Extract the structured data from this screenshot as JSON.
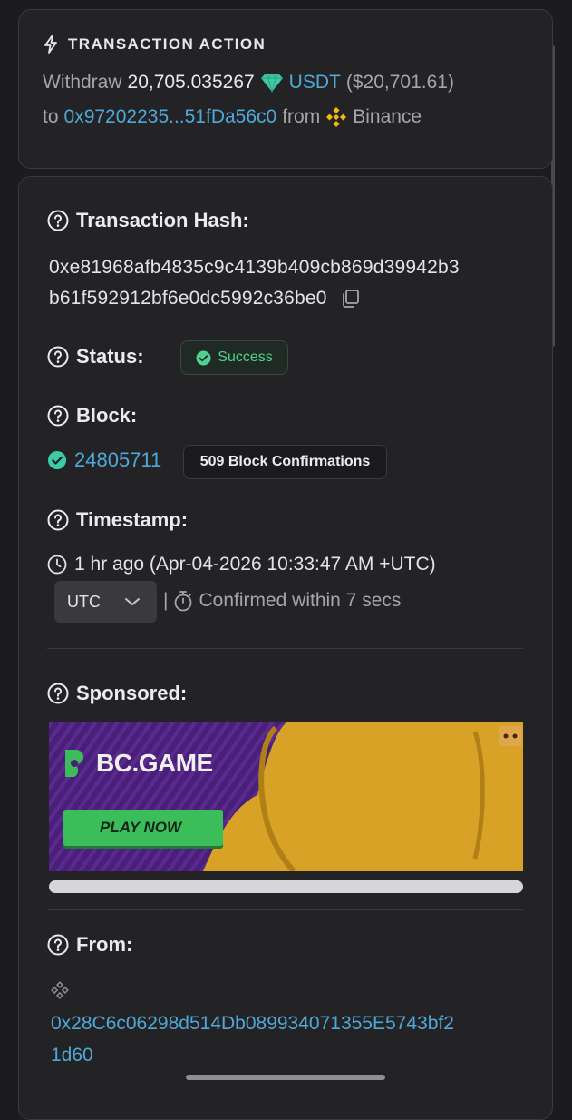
{
  "transaction_action": {
    "title": "TRANSACTION ACTION",
    "verb": "Withdraw",
    "amount": "20,705.035267",
    "token": "USDT",
    "usd_value": "($20,701.61)",
    "to_word": "to",
    "to_address": "0x97202235...51fDa56c0",
    "from_word": "from",
    "from_name": "Binance"
  },
  "hash": {
    "label": "Transaction Hash:",
    "line1": "0xe81968afb4835c9c4139b409cb869d39942b3",
    "line2": "b61f592912bf6e0dc5992c36be0"
  },
  "status": {
    "label": "Status:",
    "value": "Success"
  },
  "block": {
    "label": "Block:",
    "number": "24805711",
    "confirmations": "509 Block Confirmations"
  },
  "timestamp": {
    "label": "Timestamp:",
    "value": "1 hr ago (Apr-04-2026 10:33:47 AM +UTC)",
    "timezone": "UTC",
    "separator": "|",
    "confirmed": "Confirmed within 7 secs"
  },
  "sponsored": {
    "label": "Sponsored:",
    "brand": "BC.GAME",
    "cta": "PLAY NOW"
  },
  "from": {
    "label": "From:",
    "address_line1": "0x28C6c06298d514Db089934071355E5743bf2",
    "address_line2": "1d60"
  },
  "colors": {
    "background": "#1c1c1e",
    "card": "#232326",
    "link": "#4fa8d8",
    "success": "#4fd18f",
    "binance": "#f0b90b",
    "tether": "#3ec9a7",
    "ad_purple": "#4a1f7a",
    "ad_yellow": "#d8a227",
    "ad_green": "#3bbd5a"
  },
  "icons": [
    "lightning-icon",
    "tether-icon",
    "binance-icon",
    "question-icon",
    "copy-icon",
    "check-circle-icon",
    "clock-icon",
    "chevron-down-icon",
    "stopwatch-icon"
  ]
}
